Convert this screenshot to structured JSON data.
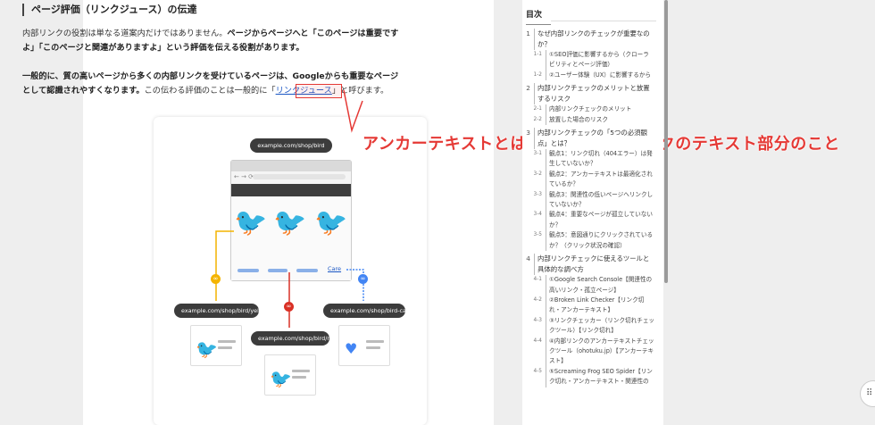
{
  "article": {
    "heading": "ページ評価（リンクジュース）の伝達",
    "p1_a": "内部リンクの役割は単なる道案内だけではありません。",
    "p1_b": "ページからページへと「このページは重要ですよ」「このページと関連がありますよ」という評価を伝える役割があります。",
    "p2_a": "一般的に、質の高いページから多くの内部リンクを受けているページは、Googleからも重要なページとして認識されやすくなります。",
    "p2_b": "この伝わる評価のことは一般的に「",
    "p2_link": "リンクジュース",
    "p2_c": "」と呼びます。"
  },
  "figure": {
    "url_top": "example.com/shop/bird",
    "url_left": "example.com/shop/bird/yellow",
    "url_mid": "example.com/shop/bird/red",
    "url_right": "example.com/shop/bird-care",
    "care_link": "Care"
  },
  "annotation": "アンカーテキストとは、このようなリンクのテキスト部分のこと",
  "toc": {
    "title": "目次",
    "items": [
      {
        "num": "1",
        "text": "なぜ内部リンクのチェックが重要なのか？",
        "level": 1
      },
      {
        "num": "1-1",
        "text": "①SEO評価に影響するから（クローラビリティとページ評価）",
        "level": 2
      },
      {
        "num": "1-2",
        "text": "②ユーザー体験（UX）に影響するから",
        "level": 2
      },
      {
        "num": "2",
        "text": "内部リンクチェックのメリットと放置するリスク",
        "level": 1
      },
      {
        "num": "2-1",
        "text": "内部リンクチェックのメリット",
        "level": 2
      },
      {
        "num": "2-2",
        "text": "放置した場合のリスク",
        "level": 2
      },
      {
        "num": "3",
        "text": "内部リンクチェックの「5つの必須観点」とは？",
        "level": 1
      },
      {
        "num": "3-1",
        "text": "観点1：リンク切れ（404エラー）は発生していないか？",
        "level": 2
      },
      {
        "num": "3-2",
        "text": "観点2：アンカーテキストは最適化されているか？",
        "level": 2
      },
      {
        "num": "3-3",
        "text": "観点3：関連性の低いページへリンクしていないか？",
        "level": 2
      },
      {
        "num": "3-4",
        "text": "観点4：重要なページが孤立していないか？",
        "level": 2
      },
      {
        "num": "3-5",
        "text": "観点5：意図通りにクリックされているか？（クリック状況の確認）",
        "level": 2
      },
      {
        "num": "4",
        "text": "内部リンクチェックに使えるツールと具体的な調べ方",
        "level": 1
      },
      {
        "num": "4-1",
        "text": "①Google Search Console【関連性の高いリンク・孤立ページ】",
        "level": 2
      },
      {
        "num": "4-2",
        "text": "②Broken Link Checker【リンク切れ・アンカーテキスト】",
        "level": 2
      },
      {
        "num": "4-3",
        "text": "③リンクチェッカー（リンク切れチェックツール）【リンク切れ】",
        "level": 2
      },
      {
        "num": "4-4",
        "text": "④内部リンクのアンカーテキストチェックツール（ohotuku.jp）【アンカーテキスト】",
        "level": 2
      },
      {
        "num": "4-5",
        "text": "⑤Screaming Frog SEO Spider【リンク切れ・アンカーテキスト・関連性の",
        "level": 2
      }
    ]
  },
  "colors": {
    "annotation": "#e53935",
    "link": "#1a56c4",
    "yellow": "#f4b400",
    "red": "#d93025",
    "blue": "#4285f4"
  }
}
